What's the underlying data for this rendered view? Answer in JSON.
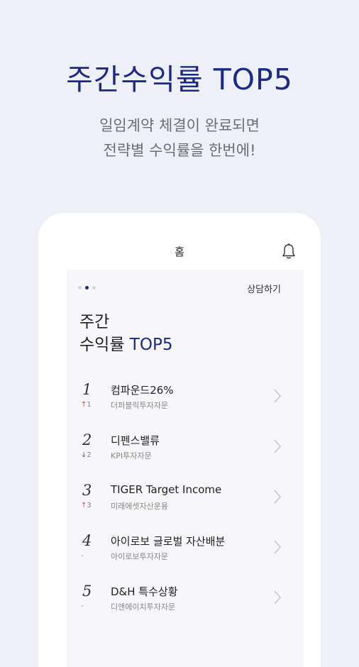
{
  "hero": {
    "title": "주간수익률 TOP5",
    "subtitle_line1": "일임계약 체결이 완료되면",
    "subtitle_line2": "전략별 수익률을 한번에!"
  },
  "topbar": {
    "title": "홈",
    "bell_icon": "bell-icon"
  },
  "panel": {
    "consult_label": "상담하기",
    "pager": {
      "count": 3,
      "active_index": 1
    },
    "title_line1": "주간",
    "title_line2_prefix": "수익률 ",
    "title_line2_accent": "TOP5"
  },
  "colors": {
    "accent": "#1c2a86",
    "up": "#e0443f",
    "down": "#3d5ab3",
    "background": "#eef0f7"
  },
  "ranking": [
    {
      "rank": "1",
      "arrow": "↑",
      "arrow_dir": "up",
      "change": "1",
      "name": "컴파운드26%",
      "company": "더퍼블릭투자자문"
    },
    {
      "rank": "2",
      "arrow": "↓",
      "arrow_dir": "down",
      "change": "2",
      "name": "디펜스밸류",
      "company": "KPI투자자문"
    },
    {
      "rank": "3",
      "arrow": "↑",
      "arrow_dir": "up",
      "change": "3",
      "name": "TIGER Target Income",
      "company": "미래에셋자산운용"
    },
    {
      "rank": "4",
      "arrow": "",
      "arrow_dir": "none",
      "change": "-",
      "name": "아이로보 글로벌 자산배분",
      "company": "아이로보투자자문"
    },
    {
      "rank": "5",
      "arrow": "",
      "arrow_dir": "none",
      "change": "-",
      "name": "D&H 특수상황",
      "company": "디앤에이치투자자문"
    }
  ]
}
